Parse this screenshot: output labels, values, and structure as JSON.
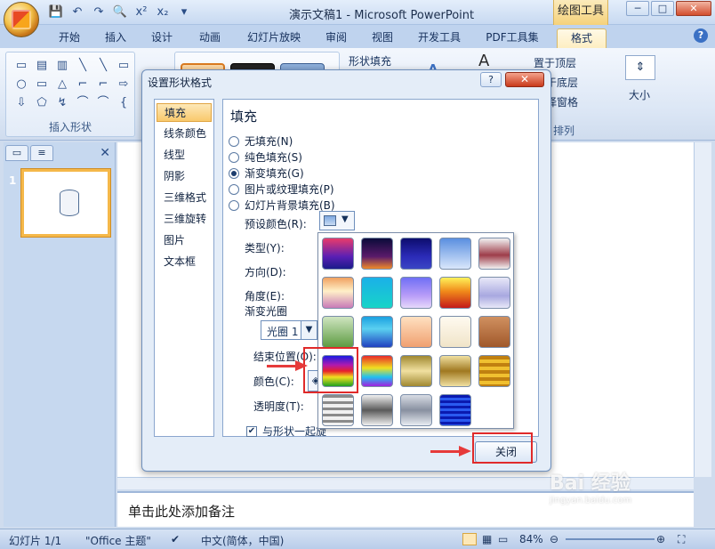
{
  "window": {
    "title": "演示文稿1 - Microsoft PowerPoint",
    "context_tab": "绘图工具",
    "controls": {
      "minimize": "─",
      "restore": "□",
      "close": "✕"
    }
  },
  "quick_access": [
    "💾",
    "↶",
    "↷",
    "🔍",
    "x²",
    "x₂",
    "▾"
  ],
  "ribbon_tabs": [
    "开始",
    "插入",
    "设计",
    "动画",
    "幻灯片放映",
    "审阅",
    "视图",
    "开发工具",
    "PDF工具集",
    "格式"
  ],
  "active_tab": "格式",
  "ribbon": {
    "insert_shapes_label": "插入形状",
    "shapes": [
      "▭",
      "▤",
      "▥",
      "╲",
      "╲",
      "▭",
      "○",
      "▭",
      "△",
      "⌐",
      "⌐",
      "⇨",
      "⇩",
      "⬠",
      "↯",
      "⌒",
      "⌒",
      "{"
    ],
    "shape_fill": "形状填充",
    "bring_front": "置于顶层",
    "send_back": "于底层",
    "selection_pane": "择窗格",
    "arrange_label": "排列",
    "size_label": "大小"
  },
  "left_panel": {
    "slide_number": "1"
  },
  "notes_placeholder": "单击此处添加备注",
  "status": {
    "slide_info": "幻灯片 1/1",
    "theme": "\"Office 主题\"",
    "language": "中文(简体，中国)",
    "zoom": "84%"
  },
  "dialog": {
    "title": "设置形状格式",
    "help": "?",
    "close_x": "✕",
    "nav": [
      "填充",
      "线条颜色",
      "线型",
      "阴影",
      "三维格式",
      "三维旋转",
      "图片",
      "文本框"
    ],
    "active_nav": "填充",
    "pane_title": "填充",
    "fill_options": [
      {
        "label": "无填充(N)",
        "checked": false
      },
      {
        "label": "纯色填充(S)",
        "checked": false
      },
      {
        "label": "渐变填充(G)",
        "checked": true
      },
      {
        "label": "图片或纹理填充(P)",
        "checked": false
      },
      {
        "label": "幻灯片背景填充(B)",
        "checked": false
      }
    ],
    "preset_colors": "预设颜色(R):",
    "type": "类型(Y):",
    "direction": "方向(D):",
    "angle": "角度(E):",
    "gradient_stops": "渐变光圈",
    "stop_value": "光圈 1",
    "end_position": "结束位置(O):",
    "color": "颜色(C):",
    "transparency": "透明度(T):",
    "rotate_with_shape": "与形状一起旋",
    "close_button": "关闭"
  },
  "gradient_presets": [
    [
      "linear-gradient(#e83b6b,#5a1fb4 60%,#1b1b8a)",
      "linear-gradient(#0b0b3a,#5a1a6a 60%,#f08a2a)",
      "linear-gradient(#0d0d6e,#2b2bb8 60%,#3a46c4)",
      "linear-gradient(#5a8fe0,#d9e7fb)",
      "linear-gradient(#f1f1f1,#9e3d4a 55%,#f1f1f1)"
    ],
    [
      "linear-gradient(#f0a060,#fff0c8 45%,#c87ab8)",
      "linear-gradient(#1ab0e8,#18d4c8)",
      "linear-gradient(#6f6ff5,#b99df8 60%,#e6d8fb)",
      "linear-gradient(#fff25a,#f08a1a 45%,#c41a1a)",
      "linear-gradient(#e8e8f8,#a8a8e0 60%,#e8e8f8)"
    ],
    [
      "linear-gradient(#cfe5c0,#5d9b42)",
      "linear-gradient(#1aa0e0,#5ad0f0 40%,#2040c0)",
      "linear-gradient(#ffe0c0,#f0a070)",
      "linear-gradient(#fffaf0,#f0e4c8)",
      "linear-gradient(#d09060,#a0582a)"
    ],
    [
      "linear-gradient(#1a1ae0,#b01ab0 30%,#e8202a 50%,#f0e020 70%,#20a020)",
      "linear-gradient(#e82a2a,#f0e020 40%,#20c0f0 70%,#a020e0)",
      "linear-gradient(#a08830,#f0e0a0 50%,#a08830)",
      "linear-gradient(#f0e0a0,#a07820 50%,#f0e0a0)",
      "repeating-linear-gradient(#c08010 0 4px,#f0c030 4px 8px)"
    ],
    [
      "repeating-linear-gradient(#8a8a8a 0 3px,#f0f0f0 3px 7px)",
      "linear-gradient(#f0f0f0,#5a5a5a 50%,#f0f0f0)",
      "linear-gradient(#d8dce4,#8890a0 50%,#e8ecf2)",
      "repeating-linear-gradient(#0a1ab0 0 3px,#2a5af0 3px 6px)"
    ]
  ],
  "watermark": {
    "brand": "Bai 经验",
    "url": "jingyan.baidu.com"
  }
}
